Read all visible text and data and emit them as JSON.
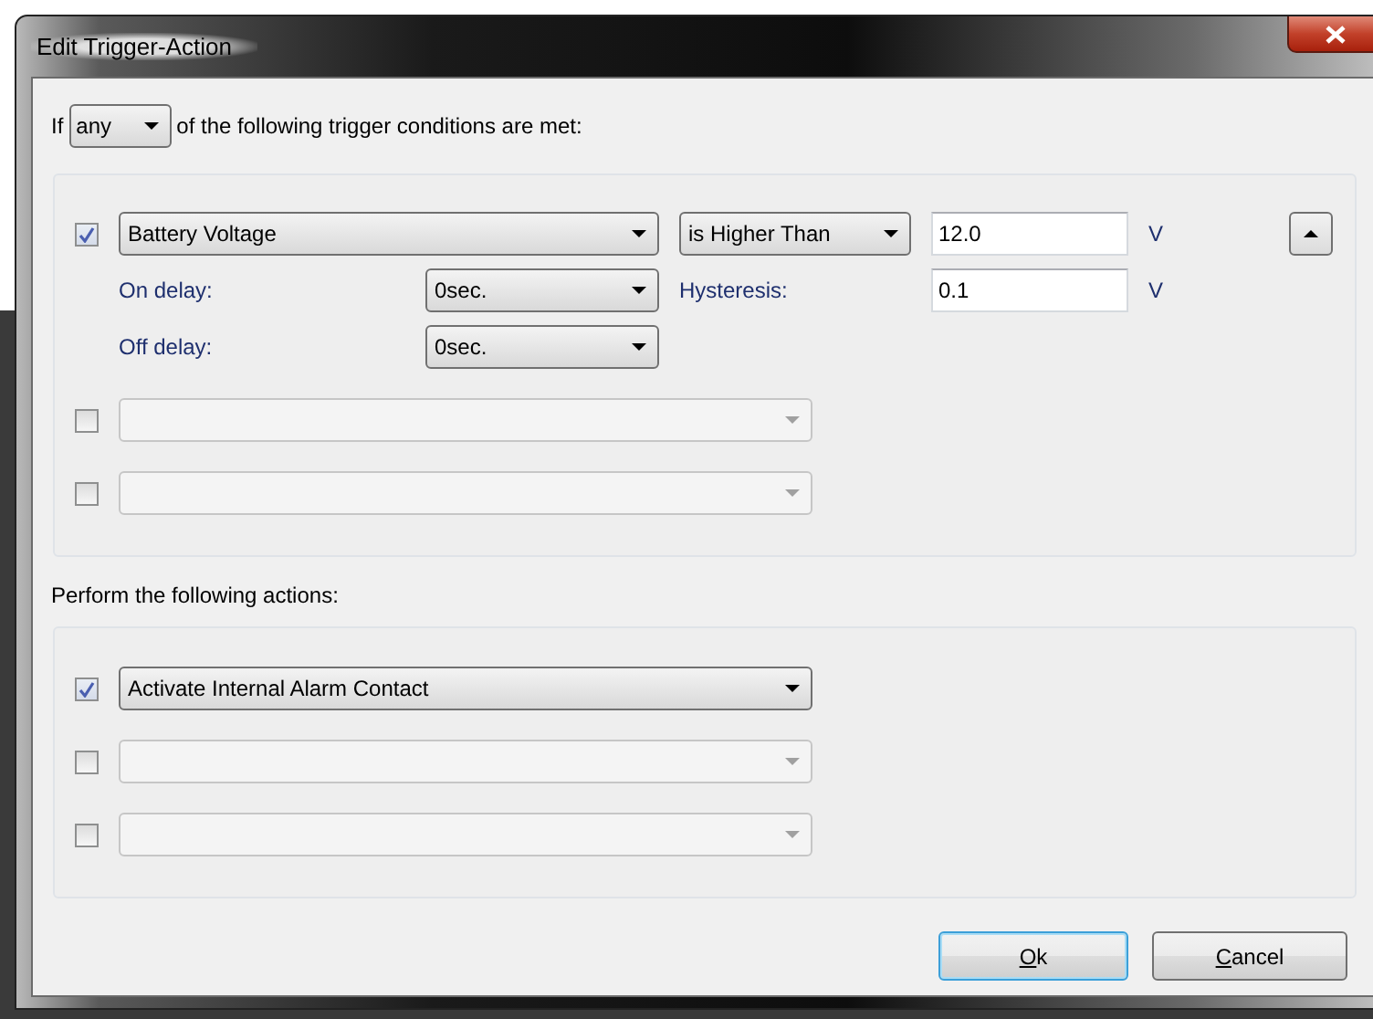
{
  "window": {
    "title": "Edit Trigger-Action"
  },
  "trigger": {
    "prefix": "If",
    "mode": "any",
    "suffix": "of the following trigger conditions are met:"
  },
  "conditions": [
    {
      "kind": "detailed",
      "checked": true,
      "disabled": false,
      "source": "Battery Voltage",
      "operator": "is Higher Than",
      "value": "12.0",
      "unit": "V",
      "on_delay_label": "On delay:",
      "on_delay": "0sec.",
      "hysteresis_label": "Hysteresis:",
      "hysteresis": "0.1",
      "hysteresis_unit": "V",
      "off_delay_label": "Off delay:",
      "off_delay": "0sec."
    },
    {
      "kind": "simple",
      "checked": false,
      "disabled": true
    },
    {
      "kind": "simple",
      "checked": false,
      "disabled": true
    }
  ],
  "actions_label": "Perform the following actions:",
  "actions": [
    {
      "checked": true,
      "disabled": false,
      "value": "Activate Internal Alarm Contact"
    },
    {
      "checked": false,
      "disabled": true
    },
    {
      "checked": false,
      "disabled": true
    }
  ],
  "buttons": [
    {
      "label": "Ok",
      "default": true
    },
    {
      "label": "Cancel",
      "default": false
    }
  ]
}
